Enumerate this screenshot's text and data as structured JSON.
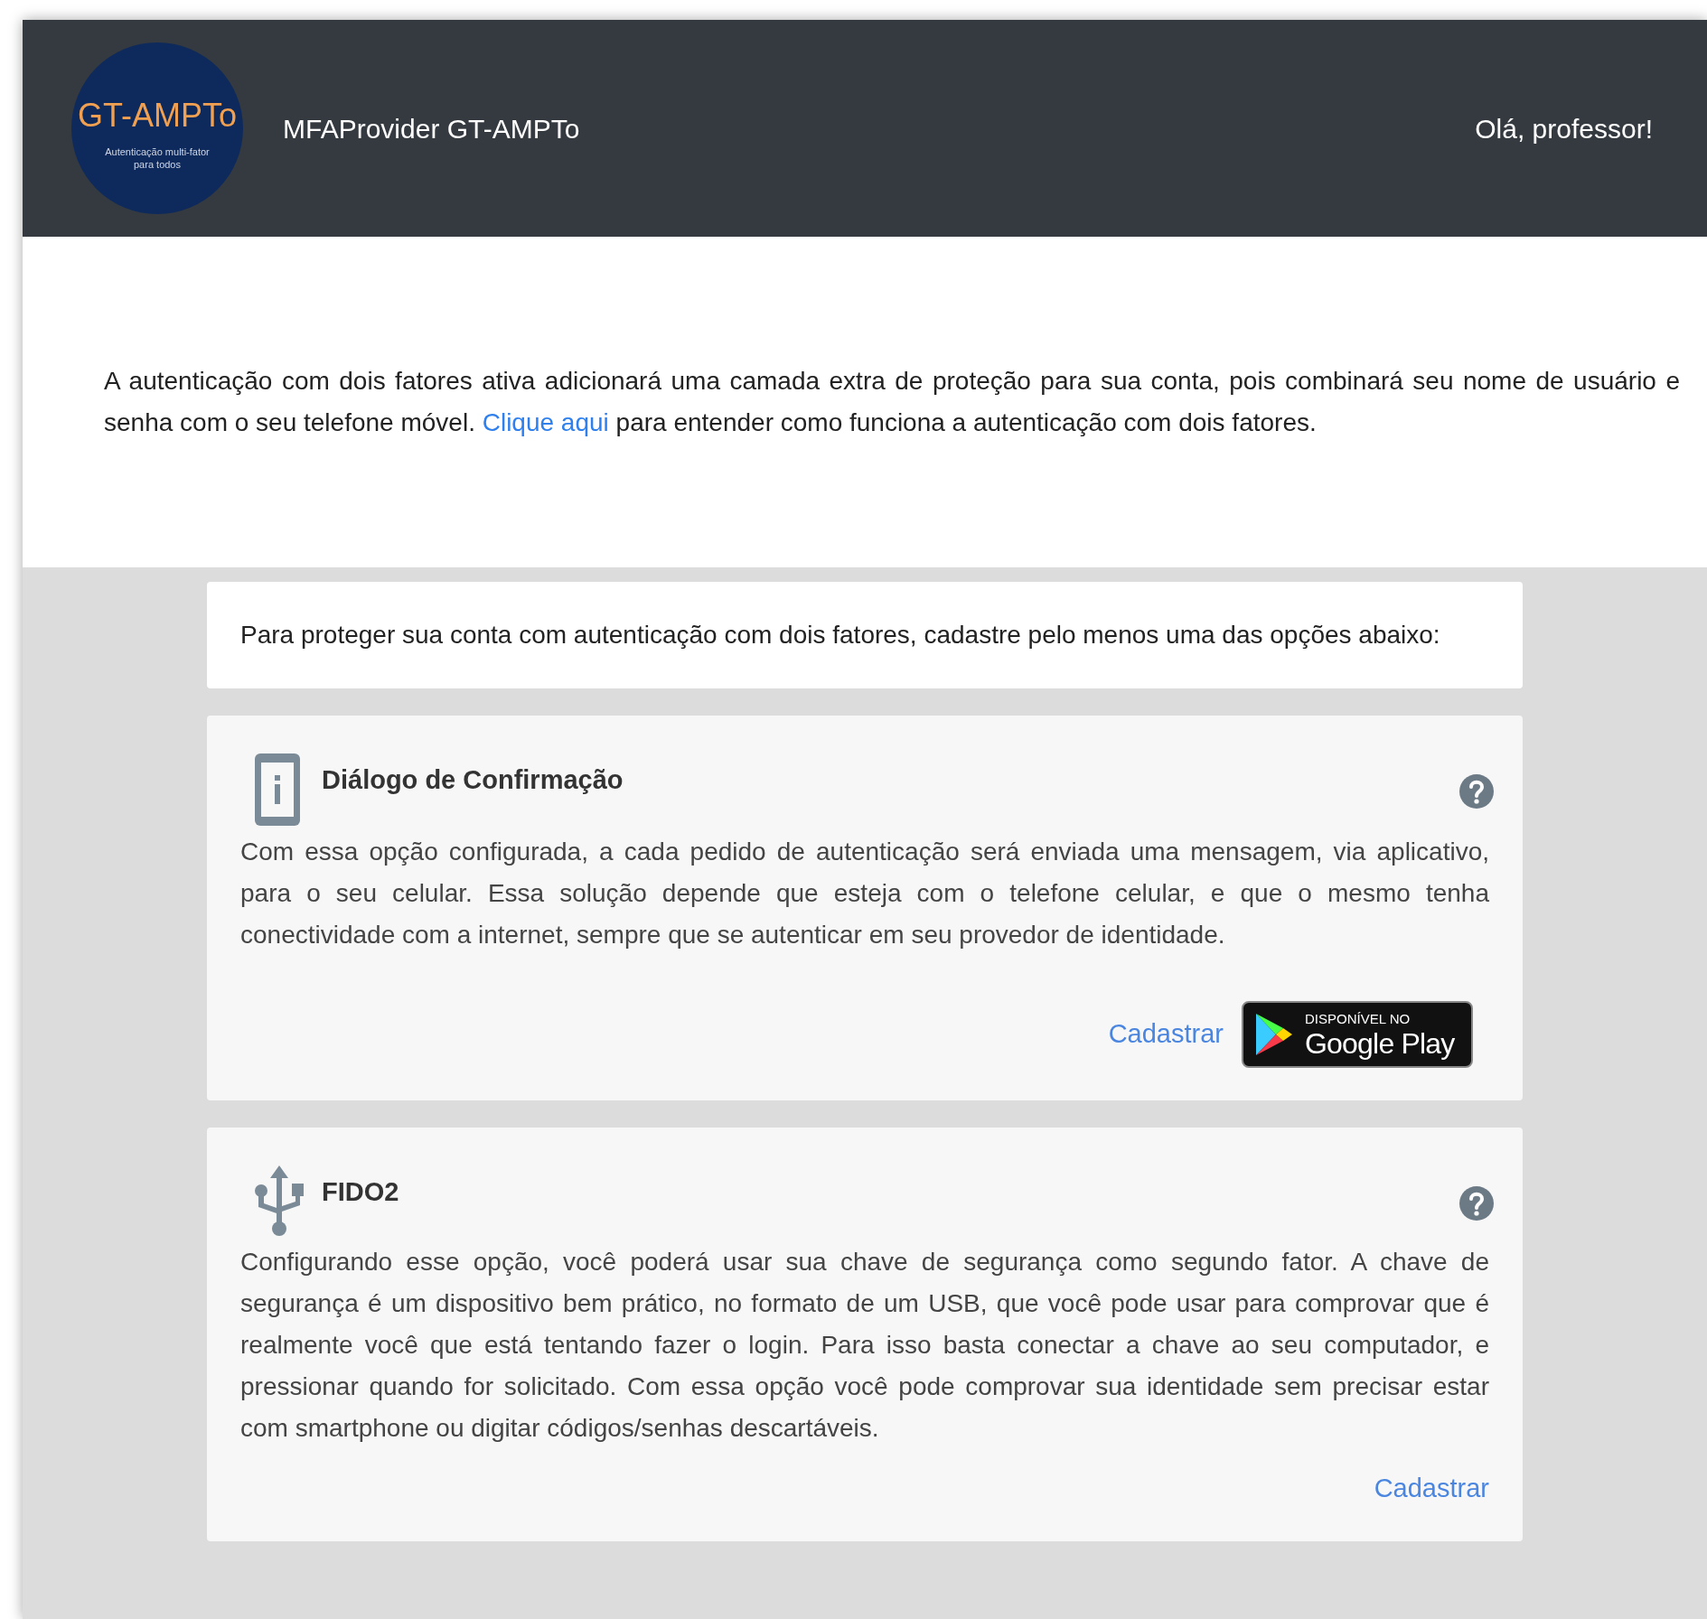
{
  "header": {
    "logo": {
      "title": "GT-AMPTo",
      "subtitle": "Autenticação multi-fator para todos"
    },
    "app_title": "MFAProvider GT-AMPTo",
    "greeting": "Olá, professor!"
  },
  "intro": {
    "before": "A autenticação com dois fatores ativa adicionará uma camada extra de proteção para sua conta, pois combinará seu nome de usuário e senha com o seu telefone móvel.",
    "link": "Clique aqui",
    "after": "para entender como funciona a autenticação com dois fatores."
  },
  "notice": "Para proteger sua conta com autenticação com dois fatores, cadastre pelo menos uma das opções abaixo:",
  "options": [
    {
      "kind": "phone",
      "title": "Diálogo de Confirmação",
      "description": "Com essa opção configurada, a cada pedido de autenticação será enviada uma mensagem, via aplicativo, para o seu celular. Essa solução depende que esteja com o telefone celular, e que o mesmo tenha conectividade com a internet, sempre que se autenticar em seu provedor de identidade.",
      "register": "Cadastrar",
      "store_badge": {
        "small": "DISPONÍVEL NO",
        "big": "Google Play"
      }
    },
    {
      "kind": "usb",
      "title": "FIDO2",
      "description": "Configurando esse opção, você poderá usar sua chave de segurança como segundo fator. A chave de segurança é um dispositivo bem prático, no formato de um USB, que você pode usar para comprovar que é realmente você que está tentando fazer o login. Para isso basta conectar a chave ao seu computador, e pressionar quando for solicitado. Com essa opção você pode comprovar sua identidade sem precisar estar com smartphone ou digitar códigos/senhas descartáveis.",
      "register": "Cadastrar"
    }
  ]
}
